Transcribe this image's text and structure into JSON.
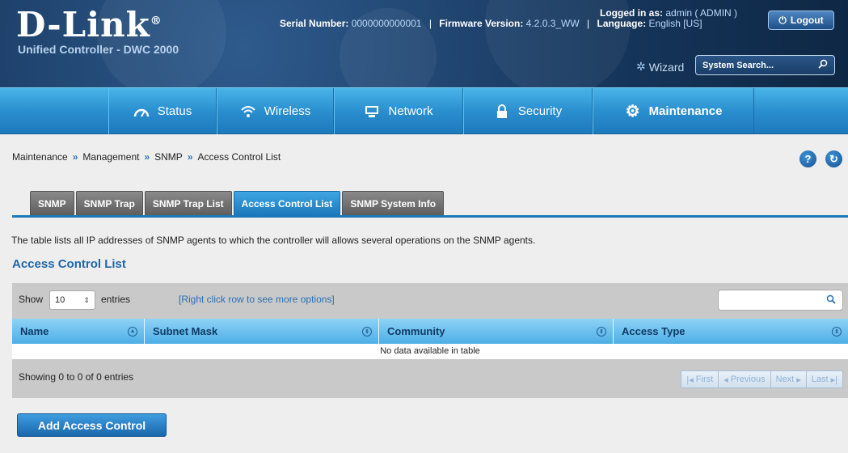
{
  "header": {
    "brand": "D-Link",
    "brand_mark": "®",
    "subtitle": "Unified Controller - DWC 2000",
    "serial_label": "Serial Number:",
    "serial_value": "0000000000001",
    "firmware_label": "Firmware Version:",
    "firmware_value": "4.2.0.3_WW",
    "language_label": "Language:",
    "language_value": "English [US]",
    "logged_label": "Logged in as:",
    "logged_value": "admin ( ADMIN )",
    "logout_label": "Logout",
    "wizard_label": "Wizard",
    "search_placeholder": "System Search..."
  },
  "nav": [
    {
      "label": "Status",
      "icon": "dashboard-icon",
      "active": false
    },
    {
      "label": "Wireless",
      "icon": "wifi-icon",
      "active": false
    },
    {
      "label": "Network",
      "icon": "monitor-icon",
      "active": false
    },
    {
      "label": "Security",
      "icon": "lock-icon",
      "active": false
    },
    {
      "label": "Maintenance",
      "icon": "gears-icon",
      "active": true
    }
  ],
  "breadcrumb": [
    "Maintenance",
    "Management",
    "SNMP",
    "Access Control List"
  ],
  "tabs": [
    {
      "label": "SNMP",
      "active": false
    },
    {
      "label": "SNMP Trap",
      "active": false
    },
    {
      "label": "SNMP Trap List",
      "active": false
    },
    {
      "label": "Access Control List",
      "active": true
    },
    {
      "label": "SNMP System Info",
      "active": false
    }
  ],
  "description": "The table lists all IP addresses of SNMP agents to which the controller will allows several operations on the SNMP agents.",
  "section_title": "Access Control List",
  "table": {
    "show_label": "Show",
    "show_value": "10",
    "entries_label": "entries",
    "hint": "[Right click row to see more options]",
    "columns": [
      "Name",
      "Subnet Mask",
      "Community",
      "Access Type"
    ],
    "empty_text": "No data available in table",
    "showing_text": "Showing 0 to 0 of 0 entries",
    "pager": {
      "first": "First",
      "previous": "Previous",
      "next": "Next",
      "last": "Last"
    }
  },
  "add_button": "Add Access Control",
  "colors": {
    "accent": "#1c78bc",
    "header": "#16365c",
    "link": "#2a6fb4"
  }
}
